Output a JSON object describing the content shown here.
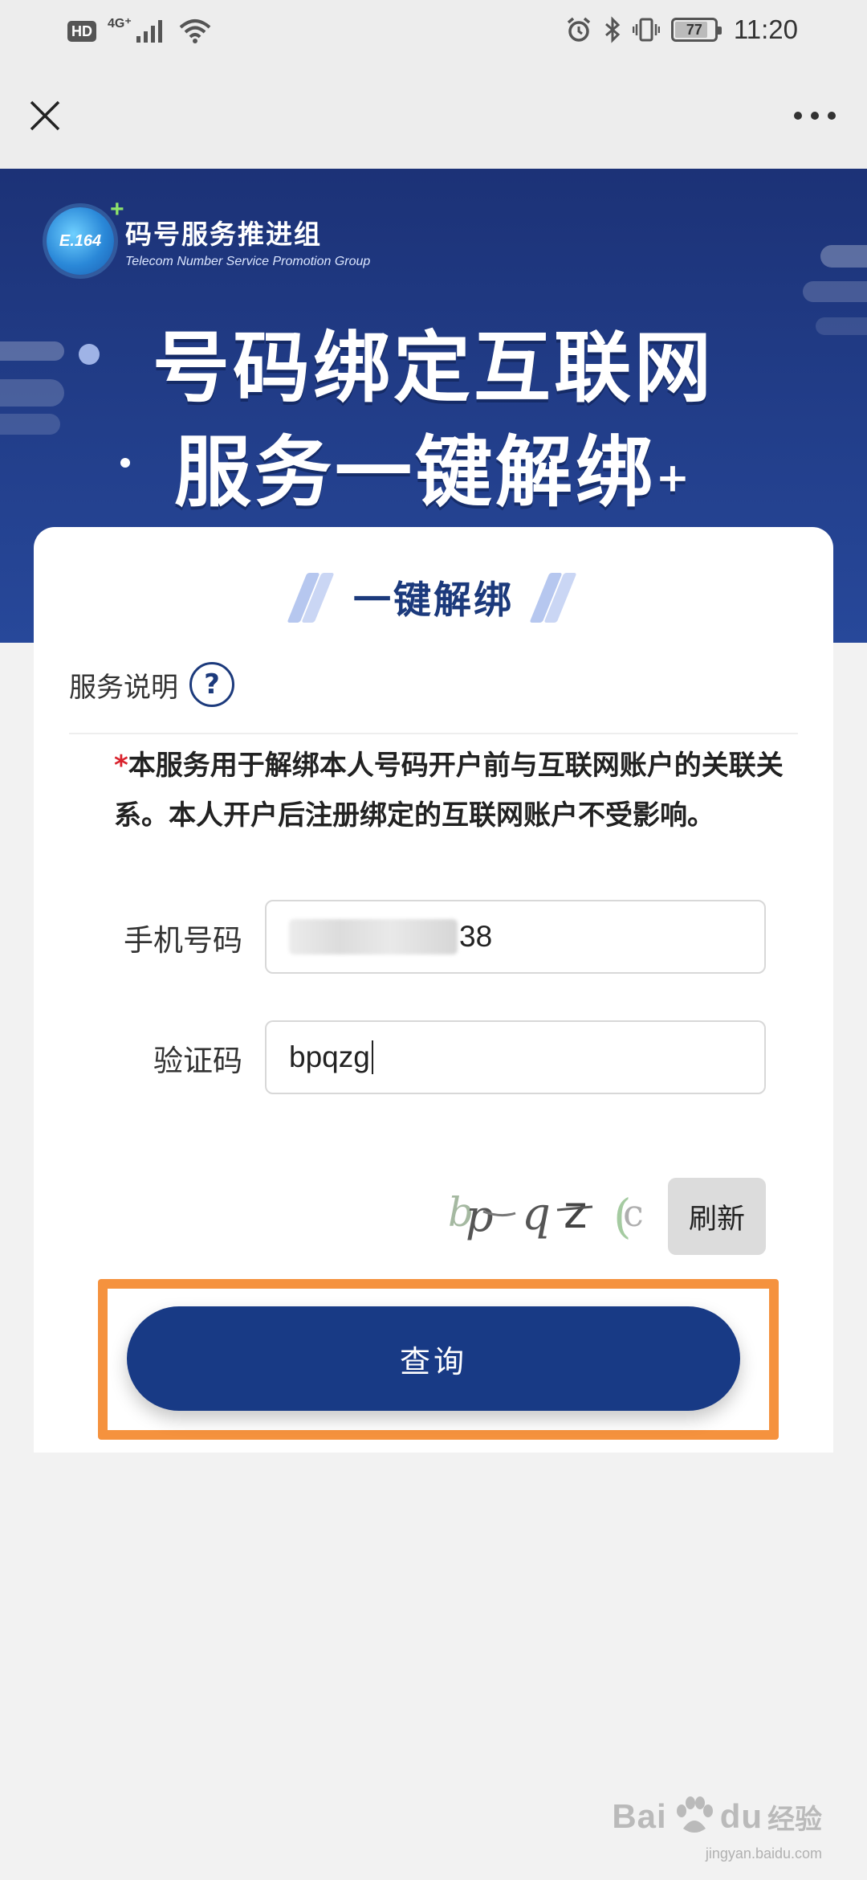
{
  "status_bar": {
    "hd": "HD",
    "network": "4G⁺",
    "battery": "77",
    "time": "11:20"
  },
  "nav": {
    "close_icon": "close-icon",
    "more_icon": "more-icon"
  },
  "banner": {
    "logo_mark": "E.164",
    "logo_cn": "码号服务推进组",
    "logo_en": "Telecom Number Service  Promotion Group",
    "headline_line1": "号码绑定互联网",
    "headline_line2": "服务一键解绑",
    "headline_plus": "+"
  },
  "card": {
    "title": "一键解绑",
    "service_label": "服务说明",
    "help_icon": "?",
    "notice_asterisk": "*",
    "notice_text": "本服务用于解绑本人号码开户前与互联网账户的关联关系。本人开户后注册绑定的互联网账户不受影响。",
    "phone_label": "手机号码",
    "phone_value_visible": "38",
    "captcha_label": "验证码",
    "captcha_value": "bpqzg",
    "captcha_image_text": "bp q z c",
    "refresh_label": "刷新",
    "query_label": "查询",
    "highlight_color": "#f5923e",
    "primary_color": "#183a85"
  },
  "watermark": {
    "brand": "Bai",
    "brand2": "du",
    "cn": "经验",
    "url": "jingyan.baidu.com"
  }
}
